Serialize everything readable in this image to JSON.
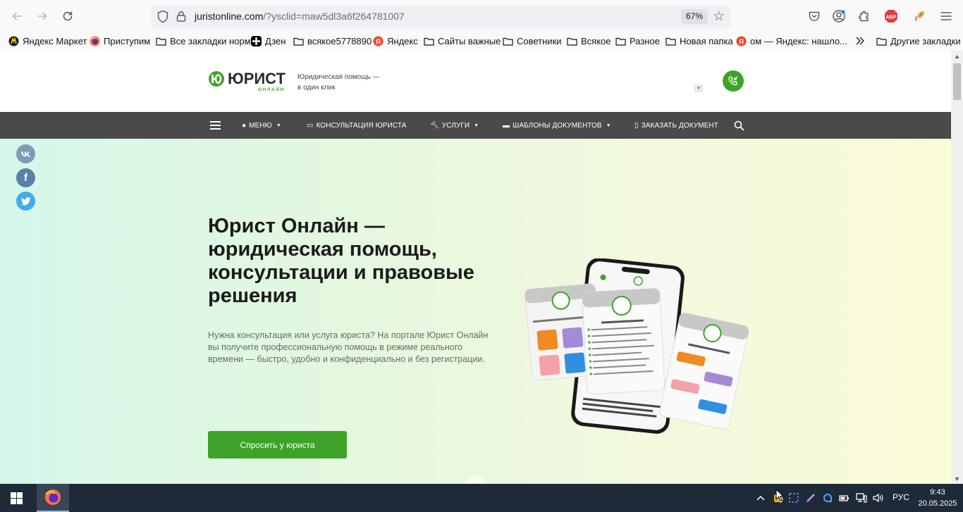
{
  "browser": {
    "url_main": "juristonline.com",
    "url_rest": "/?ysclid=maw5dl3a6f264781007",
    "zoom": "67%",
    "bookmarks": [
      {
        "label": "Яндекс Маркет",
        "icon": "yandex-market-icon"
      },
      {
        "label": "Приступим",
        "icon": "firefox-icon"
      },
      {
        "label": "Все закладки норм",
        "icon": "folder-icon"
      },
      {
        "label": "Дзен",
        "icon": "dzen-icon"
      },
      {
        "label": "всякое5778890",
        "icon": "folder-icon"
      },
      {
        "label": "Яндекс",
        "icon": "yandex-icon"
      },
      {
        "label": "Сайты важные",
        "icon": "folder-icon"
      },
      {
        "label": "Советники",
        "icon": "folder-icon"
      },
      {
        "label": "Всякое",
        "icon": "folder-icon"
      },
      {
        "label": "Разное",
        "icon": "folder-icon"
      },
      {
        "label": "Новая папка",
        "icon": "folder-icon"
      },
      {
        "label": "ом — Яндекс: нашло...",
        "icon": "yandex-icon"
      }
    ],
    "other_bookmarks": "Другие закладки"
  },
  "site": {
    "logo_main": "ЮРИСТ",
    "logo_sub": "ОНЛАЙН",
    "tagline_1": "Юридическая помощь —",
    "tagline_2": "в один клик",
    "nav": {
      "menu": "МЕНЮ",
      "consult": "КОНСУЛЬТАЦИЯ ЮРИСТА",
      "services": "УСЛУГИ",
      "templates": "ШАБЛОНЫ ДОКУМЕНТОВ",
      "order": "ЗАКАЗАТЬ ДОКУМЕНТ"
    },
    "hero": {
      "title": "Юрист Онлайн — юридическая помощь, консультации и правовые решения",
      "description": "Нужна консультация или услуга юриста? На портале Юрист Онлайн вы получите профессиональную помощь в режиме реального времени — быстро, удобно и конфиденциально и без регистрации.",
      "cta": "Спросить у юриста"
    },
    "colors": {
      "brand_green": "#3ea329",
      "nav_bg": "#4a4a4a"
    }
  },
  "taskbar": {
    "language": "РУС",
    "time": "9:43",
    "date": "20.05.2025"
  }
}
